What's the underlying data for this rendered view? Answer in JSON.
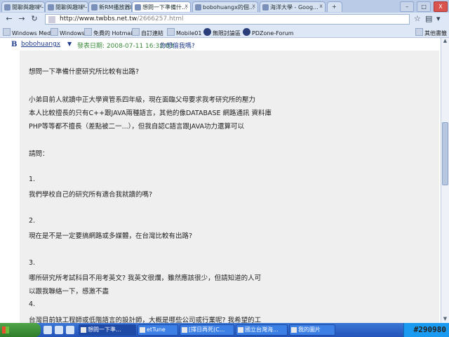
{
  "tabs": [
    {
      "label": "閒聊與趣味 - M...",
      "active": false
    },
    {
      "label": "閒聊與趣味 - Mo...",
      "active": false
    },
    {
      "label": "新RM播放器KB...",
      "active": false
    },
    {
      "label": "想問一下準備什...",
      "active": true
    },
    {
      "label": "bobohuangx的個...",
      "active": false
    },
    {
      "label": "海洋大學 - Goog...",
      "active": false
    }
  ],
  "window_controls": {
    "minimize": "–",
    "maximize": "□",
    "close": "X"
  },
  "nav": {
    "back": "←",
    "forward": "→",
    "reload": "↻",
    "url_host": "http://www.twbbs.net.tw",
    "url_path": "/2666257.html",
    "star": "☆",
    "page_menu": "▤",
    "tools_menu": "▾"
  },
  "bookmarks": [
    {
      "label": "Windows Media",
      "icon": "page-icon"
    },
    {
      "label": "Windows",
      "icon": "page-icon"
    },
    {
      "label": "免費的 Hotmail",
      "icon": "page-icon"
    },
    {
      "label": "自訂連結",
      "icon": "page-icon"
    },
    {
      "label": "Mobile01",
      "icon": "page-icon"
    },
    {
      "label": "無限討論區",
      "icon": "circle-icon"
    },
    {
      "label": "PDZone-Forum",
      "icon": "circle-icon"
    }
  ],
  "other_bookmarks": "其他書籤",
  "post": {
    "author_icon": "B",
    "author": "bobohuangx",
    "date_label": "發表日期: 2008-07-11 16:32:03",
    "helpful": "你想偷我嗎?",
    "lines": [
      "想問一下準備什麼研究所比較有出路?",
      "",
      "小弟目前人就讀中正大學資管系四年級，現在面臨父母要求我考研究所的壓力",
      "本人比較擅長的只有C++跟JAVA兩種語言，其他的像DATABASE 網路通訊 資料庫",
      "PHP等等都不擅長（差點被二一...），但我自認C語言跟JAVA功力還算可以",
      "",
      "請問：",
      "",
      "1.",
      "我們學校自己的研究所有適合我就讀的嗎?",
      "",
      "2.",
      "現在是不是一定要搞網路或多媒體，在台灣比較有出路?",
      "",
      "3.",
      "哪所研究所考試科目不用考英文? 我英文很爛，雖然應該很少，但請知道的人可",
      "以跟我聯絡一下，感激不盡",
      "4.",
      "台灣目前缺工程師或低階語言的設計師，大概是哪些公司或行業呢? 我希望的工"
    ]
  },
  "taskbar": {
    "start_label": "",
    "tasks": [
      {
        "label": "想問一下準...",
        "active": true
      },
      {
        "label": "etTune",
        "active": false
      },
      {
        "label": "[擇日再死(C...",
        "active": false
      },
      {
        "label": "國立台灣海...",
        "active": false
      },
      {
        "label": "我的圖片",
        "active": false
      }
    ],
    "watermark": "#290980"
  }
}
